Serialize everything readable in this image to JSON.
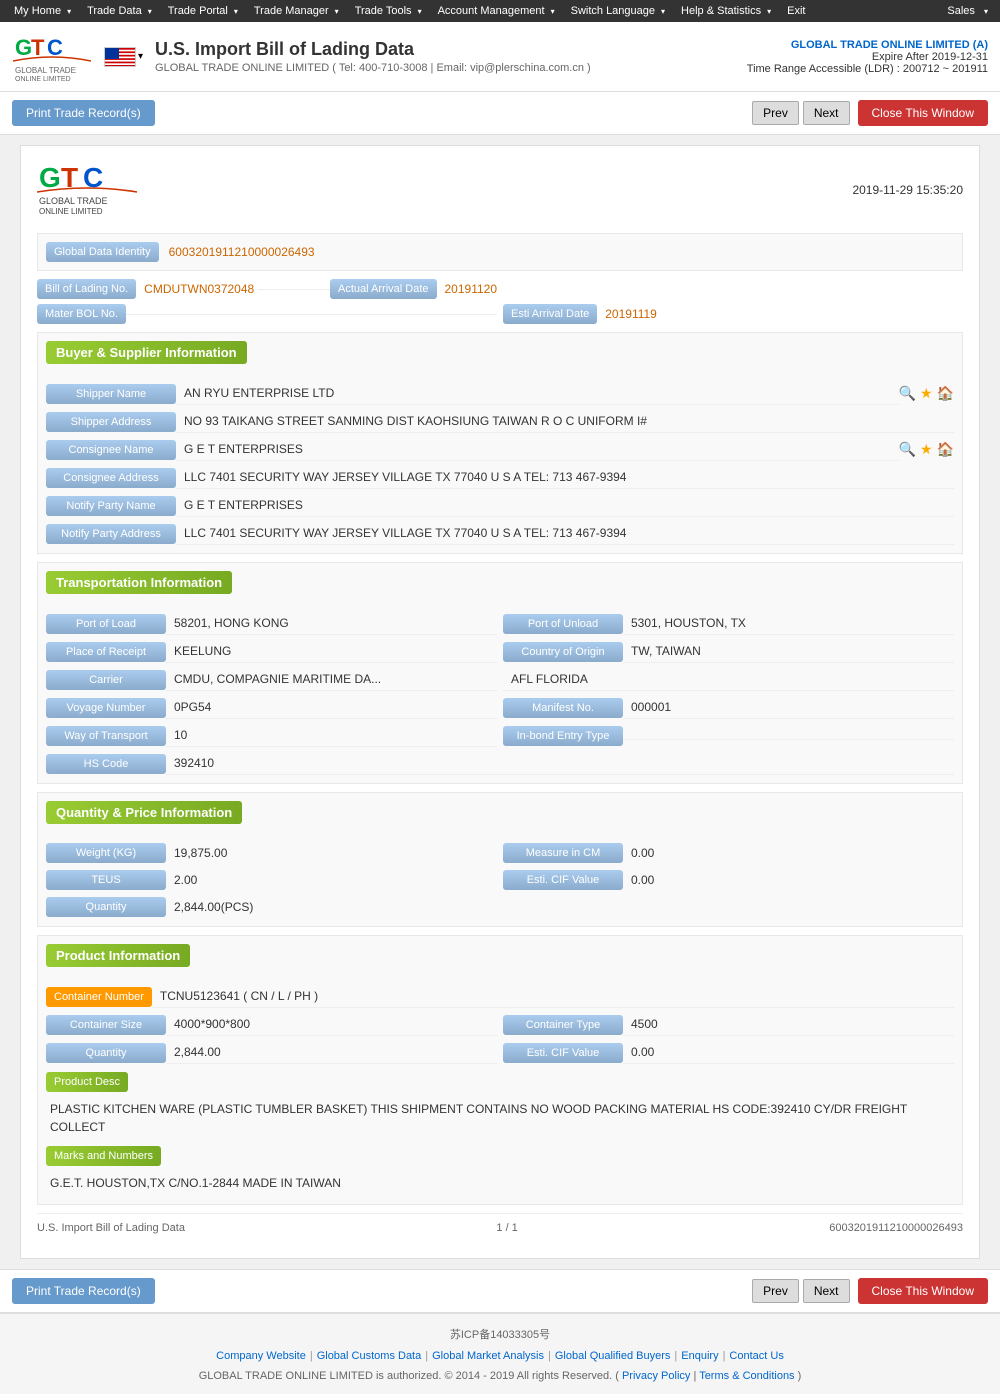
{
  "topNav": {
    "items": [
      "My Home",
      "Trade Data",
      "Trade Portal",
      "Trade Manager",
      "Trade Tools",
      "Account Management",
      "Switch Language",
      "Help & Statistics",
      "Exit"
    ],
    "right": "Sales"
  },
  "header": {
    "title": "U.S. Import Bill of Lading Data",
    "subtitle": "GLOBAL TRADE ONLINE LIMITED ( Tel: 400-710-3008 | Email: vip@plerschina.com.cn )",
    "company": "GLOBAL TRADE ONLINE LIMITED (A)",
    "expire": "Expire After 2019-12-31",
    "ldr": "Time Range Accessible (LDR) : 200712 ~ 201911"
  },
  "toolbar": {
    "print_label": "Print Trade Record(s)",
    "prev_label": "Prev",
    "next_label": "Next",
    "close_label": "Close This Window"
  },
  "doc": {
    "date": "2019-11-29 15:35:20",
    "globalDataIdentity_label": "Global Data Identity",
    "globalDataIdentity_value": "6003201911210000026493",
    "bolNo_label": "Bill of Lading No.",
    "bolNo_value": "CMDUTWN0372048",
    "actualArrivalDate_label": "Actual Arrival Date",
    "actualArrivalDate_value": "20191120",
    "materBolNo_label": "Mater BOL No.",
    "materBolNo_value": "",
    "estiArrivalDate_label": "Esti Arrival Date",
    "estiArrivalDate_value": "20191119"
  },
  "buyerSupplier": {
    "section_label": "Buyer & Supplier Information",
    "shipperName_label": "Shipper Name",
    "shipperName_value": "AN RYU ENTERPRISE LTD",
    "shipperAddress_label": "Shipper Address",
    "shipperAddress_value": "NO 93 TAIKANG STREET SANMING DIST KAOHSIUNG TAIWAN R O C UNIFORM I#",
    "consigneeName_label": "Consignee Name",
    "consigneeName_value": "G E T ENTERPRISES",
    "consigneeAddress_label": "Consignee Address",
    "consigneeAddress_value": "LLC 7401 SECURITY WAY JERSEY VILLAGE TX 77040 U S A TEL: 713 467-9394",
    "notifyPartyName_label": "Notify Party Name",
    "notifyPartyName_value": "G E T ENTERPRISES",
    "notifyPartyAddress_label": "Notify Party Address",
    "notifyPartyAddress_value": "LLC 7401 SECURITY WAY JERSEY VILLAGE TX 77040 U S A TEL: 713 467-9394"
  },
  "transportation": {
    "section_label": "Transportation Information",
    "portOfLoad_label": "Port of Load",
    "portOfLoad_value": "58201, HONG KONG",
    "portOfUnload_label": "Port of Unload",
    "portOfUnload_value": "5301, HOUSTON, TX",
    "placeOfReceipt_label": "Place of Receipt",
    "placeOfReceipt_value": "KEELUNG",
    "countryOfOrigin_label": "Country of Origin",
    "countryOfOrigin_value": "TW, TAIWAN",
    "carrier_label": "Carrier",
    "carrier_value": "CMDU, COMPAGNIE MARITIME DA...",
    "carrierDest_label": "",
    "carrierDest_value": "AFL FLORIDA",
    "voyageNumber_label": "Voyage Number",
    "voyageNumber_value": "0PG54",
    "manifestNo_label": "Manifest No.",
    "manifestNo_value": "000001",
    "wayOfTransport_label": "Way of Transport",
    "wayOfTransport_value": "10",
    "inBondEntryType_label": "In-bond Entry Type",
    "inBondEntryType_value": "",
    "hsCode_label": "HS Code",
    "hsCode_value": "392410"
  },
  "quantity": {
    "section_label": "Quantity & Price Information",
    "weight_label": "Weight (KG)",
    "weight_value": "19,875.00",
    "measureInCM_label": "Measure in CM",
    "measureInCM_value": "0.00",
    "teus_label": "TEUS",
    "teus_value": "2.00",
    "estiCIFValue_label": "Esti. CIF Value",
    "estiCIFValue_value": "0.00",
    "quantity_label": "Quantity",
    "quantity_value": "2,844.00(PCS)"
  },
  "product": {
    "section_label": "Product Information",
    "containerNumber_label": "Container Number",
    "containerNumber_value": "TCNU5123641 ( CN / L / PH )",
    "containerSize_label": "Container Size",
    "containerSize_value": "4000*900*800",
    "containerType_label": "Container Type",
    "containerType_value": "4500",
    "quantity_label": "Quantity",
    "quantity_value": "2,844.00",
    "estiCIFValue_label": "Esti. CIF Value",
    "estiCIFValue_value": "0.00",
    "productDesc_label": "Product Desc",
    "productDesc_value": "PLASTIC KITCHEN WARE (PLASTIC TUMBLER BASKET) THIS SHIPMENT CONTAINS NO WOOD PACKING MATERIAL HS CODE:392410 CY/DR FREIGHT COLLECT",
    "marksAndNumbers_label": "Marks and Numbers",
    "marksAndNumbers_value": "G.E.T. HOUSTON,TX C/NO.1-2844 MADE IN TAIWAN"
  },
  "docFooter": {
    "left": "U.S. Import Bill of Lading Data",
    "middle": "1 / 1",
    "right": "6003201911210000026493"
  },
  "footer": {
    "icp": "苏ICP备14033305号",
    "links": [
      "Company Website",
      "Global Customs Data",
      "Global Market Analysis",
      "Global Qualified Buyers",
      "Enquiry",
      "Contact Us"
    ],
    "copyright": "GLOBAL TRADE ONLINE LIMITED is authorized. © 2014 - 2019 All rights Reserved.  (  Privacy Policy  |  Terms & Conditions  )",
    "privacyPolicy": "Privacy Policy",
    "termsConditions": "Terms & Conditions"
  }
}
